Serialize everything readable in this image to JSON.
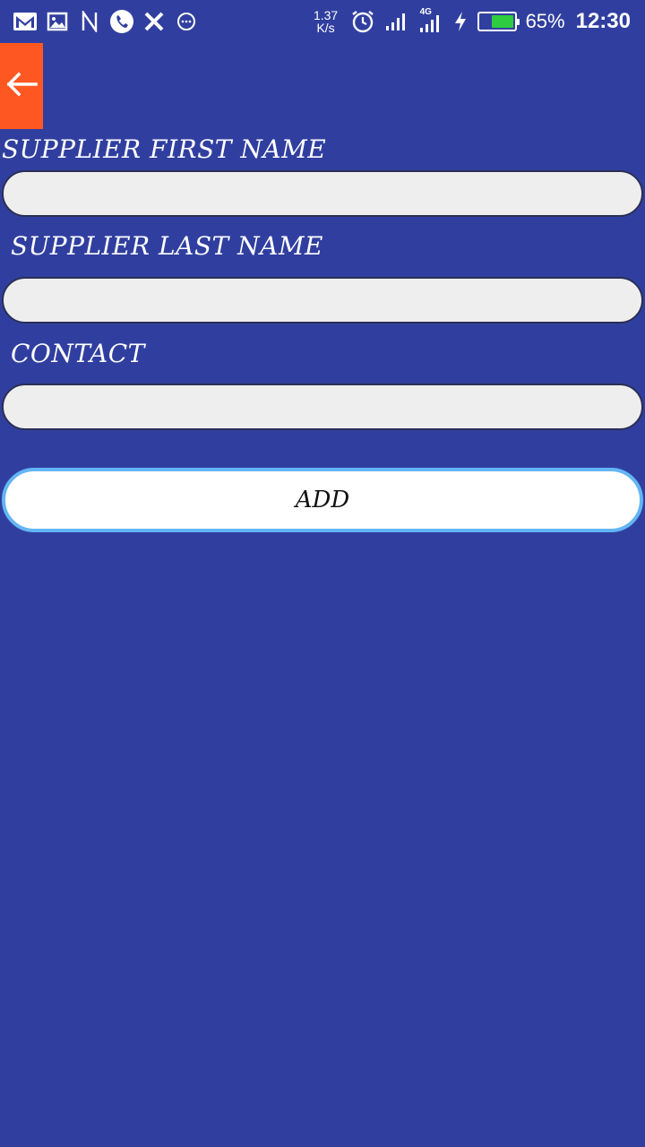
{
  "status_bar": {
    "net_speed_value": "1.37",
    "net_speed_unit": "K/s",
    "battery_percent": "65%",
    "battery_level": 0.65,
    "time": "12:30",
    "network_type": "4G",
    "left_icons": [
      "gmail-icon",
      "gallery-icon",
      "n-app-icon",
      "phone-icon",
      "x-app-icon",
      "chat-more-icon"
    ],
    "right_icons": [
      "alarm-icon",
      "signal-icon",
      "signal-4g-icon",
      "charging-icon",
      "battery-icon"
    ]
  },
  "header": {
    "back_icon": "arrow-left-icon",
    "accent_color": "#FF5722"
  },
  "form": {
    "first_name_label": "SUPPLIER FIRST NAME",
    "first_name_value": "",
    "last_name_label": "SUPPLIER LAST NAME",
    "last_name_value": "",
    "contact_label": "CONTACT",
    "contact_value": "",
    "add_button_label": "ADD"
  },
  "colors": {
    "background": "#303F9F",
    "field_bg": "#EEEEEE",
    "button_border": "#64B5F6"
  }
}
